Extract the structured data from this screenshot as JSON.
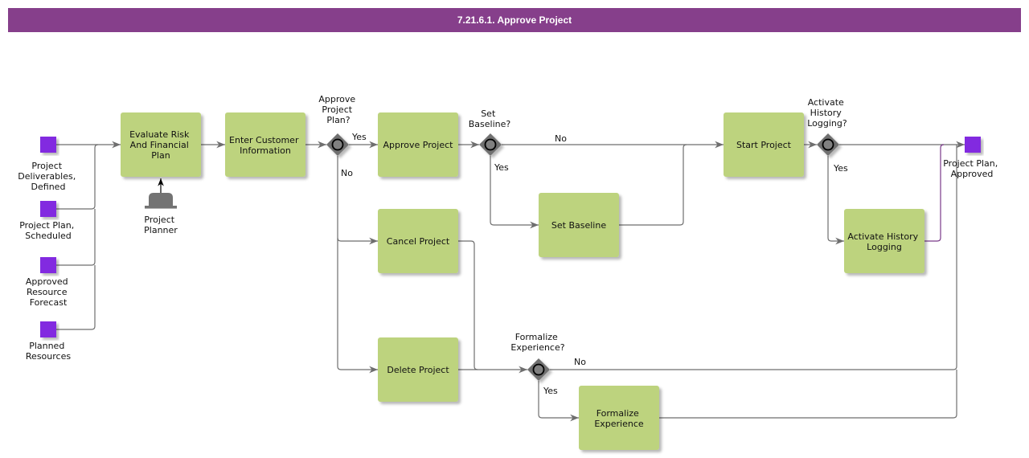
{
  "title": "7.21.6.1. Approve Project",
  "colors": {
    "title_bar": "#863f8b",
    "task_fill": "#bdd37e",
    "data_object": "#8229e0",
    "gateway": "#707070",
    "connector": "#6e6e6e"
  },
  "inputs": [
    {
      "id": "in1",
      "label": [
        "Project",
        "Deliverables,",
        "Defined"
      ]
    },
    {
      "id": "in2",
      "label": [
        "Project Plan,",
        "Scheduled"
      ]
    },
    {
      "id": "in3",
      "label": [
        "Approved",
        "Resource",
        "Forecast"
      ]
    },
    {
      "id": "in4",
      "label": [
        "Planned",
        "Resources"
      ]
    }
  ],
  "output": {
    "id": "out1",
    "label": [
      "Project Plan,",
      "Approved"
    ]
  },
  "role": {
    "label": [
      "Project",
      "Planner"
    ],
    "icon": "hat-icon"
  },
  "tasks": [
    {
      "id": "t_eval",
      "label": [
        "Evaluate Risk",
        "And Financial",
        "Plan"
      ]
    },
    {
      "id": "t_enter",
      "label": [
        "Enter Customer",
        "Information"
      ]
    },
    {
      "id": "t_approve",
      "label": [
        "Approve Project"
      ]
    },
    {
      "id": "t_cancel",
      "label": [
        "Cancel Project"
      ]
    },
    {
      "id": "t_delete",
      "label": [
        "Delete Project"
      ]
    },
    {
      "id": "t_baseline",
      "label": [
        "Set Baseline"
      ]
    },
    {
      "id": "t_start",
      "label": [
        "Start Project"
      ]
    },
    {
      "id": "t_history",
      "label": [
        "Activate History",
        "Logging"
      ]
    },
    {
      "id": "t_formalize",
      "label": [
        "Formalize",
        "Experience"
      ]
    }
  ],
  "gateways": [
    {
      "id": "g_approve",
      "question": [
        "Approve",
        "Project",
        "Plan?"
      ],
      "yes": "Yes",
      "no": "No"
    },
    {
      "id": "g_baseline",
      "question": [
        "Set",
        "Baseline?"
      ],
      "yes": "Yes",
      "no": "No"
    },
    {
      "id": "g_history",
      "question": [
        "Activate",
        "History",
        "Logging?"
      ],
      "yes": "Yes",
      "no": ""
    },
    {
      "id": "g_formalize",
      "question": [
        "Formalize",
        "Experience?"
      ],
      "yes": "Yes",
      "no": "No"
    }
  ]
}
